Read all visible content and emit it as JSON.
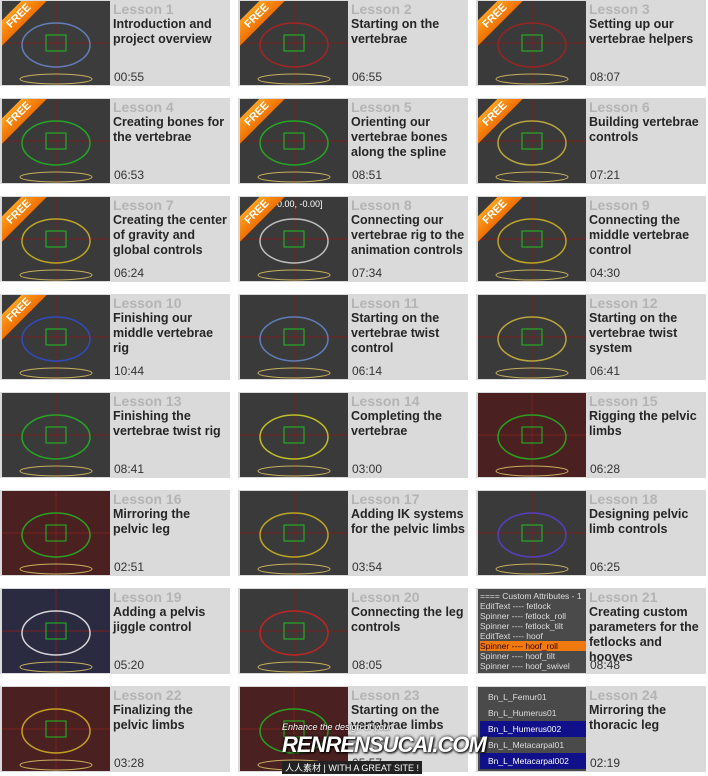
{
  "badge_label": "FREE",
  "colors": {
    "cell_bg": "#dadada",
    "lesson_number": "#b4b4b4",
    "badge": "#f58a10"
  },
  "lessons": [
    {
      "number": "Lesson 1",
      "title": "Introduction and project overview",
      "duration": "00:55",
      "free": true,
      "thumb": "#3c3c3c",
      "accent": "#6a8fd8"
    },
    {
      "number": "Lesson 2",
      "title": "Starting on the vertebrae",
      "duration": "06:55",
      "free": true,
      "thumb": "#3a3a3a",
      "accent": "#c02020"
    },
    {
      "number": "Lesson 3",
      "title": "Setting up our vertebrae helpers",
      "duration": "08:07",
      "free": true,
      "thumb": "#3a3a3a",
      "accent": "#b02020"
    },
    {
      "number": "Lesson 4",
      "title": "Creating bones for the vertebrae",
      "duration": "06:53",
      "free": true,
      "thumb": "#3a3a3a",
      "accent": "#20c020"
    },
    {
      "number": "Lesson 5",
      "title": "Orienting our vertebrae bones along the spline",
      "duration": "08:51",
      "free": true,
      "thumb": "#3a3a3a",
      "accent": "#20c020"
    },
    {
      "number": "Lesson 6",
      "title": "Building vertebrae controls",
      "duration": "07:21",
      "free": true,
      "thumb": "#3a3a3a",
      "accent": "#d8c040"
    },
    {
      "number": "Lesson 7",
      "title": "Creating the center of gravity and global controls",
      "duration": "06:24",
      "free": true,
      "thumb": "#3a3a3a",
      "accent": "#e0c020"
    },
    {
      "number": "Lesson 8",
      "title": "Connecting our vertebrae rig to the animation controls",
      "duration": "07:34",
      "free": true,
      "thumb": "#3a3a3a",
      "accent": "#e0e0e0",
      "overlay": "-0.00, -0.00]"
    },
    {
      "number": "Lesson 9",
      "title": "Connecting the middle vertebrae control",
      "duration": "04:30",
      "free": true,
      "thumb": "#3a3a3a",
      "accent": "#e0c020"
    },
    {
      "number": "Lesson 10",
      "title": "Finishing our middle vertebrae rig",
      "duration": "10:44",
      "free": true,
      "thumb": "#3a3a3a",
      "accent": "#3050e0"
    },
    {
      "number": "Lesson 11",
      "title": "Starting on the vertebrae twist control",
      "duration": "06:14",
      "free": false,
      "thumb": "#3a3a3a",
      "accent": "#6a8fd8"
    },
    {
      "number": "Lesson 12",
      "title": "Starting on the vertebrae twist system",
      "duration": "06:41",
      "free": false,
      "thumb": "#3a3a3a",
      "accent": "#d8c040"
    },
    {
      "number": "Lesson 13",
      "title": "Finishing the vertebrae twist rig",
      "duration": "08:41",
      "free": false,
      "thumb": "#3a3a3a",
      "accent": "#20c020"
    },
    {
      "number": "Lesson 14",
      "title": "Completing the vertebrae",
      "duration": "03:00",
      "free": false,
      "thumb": "#3a3a3a",
      "accent": "#e0e020"
    },
    {
      "number": "Lesson 15",
      "title": "Rigging the pelvic limbs",
      "duration": "06:28",
      "free": false,
      "thumb": "#4a2020",
      "accent": "#20c020"
    },
    {
      "number": "Lesson 16",
      "title": "Mirroring the pelvic leg",
      "duration": "02:51",
      "free": false,
      "thumb": "#4a2020",
      "accent": "#20c020"
    },
    {
      "number": "Lesson 17",
      "title": "Adding IK systems for the pelvic limbs",
      "duration": "03:54",
      "free": false,
      "thumb": "#3a3a3a",
      "accent": "#e0c020"
    },
    {
      "number": "Lesson 18",
      "title": "Designing pelvic limb controls",
      "duration": "06:25",
      "free": false,
      "thumb": "#3a3a3a",
      "accent": "#6040e0"
    },
    {
      "number": "Lesson 19",
      "title": "Adding a pelvis jiggle control",
      "duration": "05:20",
      "free": false,
      "thumb": "#2a2a40",
      "accent": "#ffffff"
    },
    {
      "number": "Lesson 20",
      "title": "Connecting the leg controls",
      "duration": "08:05",
      "free": false,
      "thumb": "#3a3a3a",
      "accent": "#e02020"
    },
    {
      "number": "Lesson 21",
      "title": "Creating custom parameters for the fetlocks and hooves",
      "duration": "08:48",
      "free": false,
      "thumb": "#4a4a4a",
      "accent": "#f07a10",
      "list": [
        "==== Custom Attributes - 1",
        "EditText ---- fetlock",
        "Spinner ---- fetlock_roll",
        "Spinner ---- fetlock_tilt",
        "EditText ---- hoof",
        "Spinner ---- hoof_roll",
        "Spinner ---- hoof_tilt",
        "Spinner ---- hoof_swivel"
      ],
      "highlight": [
        5
      ]
    },
    {
      "number": "Lesson 22",
      "title": "Finalizing the pelvic limbs",
      "duration": "03:28",
      "free": false,
      "thumb": "#4a2020",
      "accent": "#e0c020"
    },
    {
      "number": "Lesson 23",
      "title": "Starting on the vertebrae limbs",
      "duration": "05:57",
      "free": false,
      "thumb": "#4a2020",
      "accent": "#20c020"
    },
    {
      "number": "Lesson 24",
      "title": "Mirroring the thoracic leg",
      "duration": "02:19",
      "free": false,
      "thumb": "#4a4a4a",
      "accent": "#10108a",
      "list": [
        "Bn_L_Femur01",
        "Bn_L_Humerus01",
        "Bn_L_Humerus002",
        "Bn_L_Metacarpal01",
        "Bn_L_Metacarpal002"
      ],
      "highlight": [
        2,
        4
      ]
    }
  ],
  "watermark": {
    "line1": "Enhance the design of your",
    "brand": "RENRENSUCAI.COM",
    "line3": "人人素材 | WITH A GREAT SITE !"
  }
}
